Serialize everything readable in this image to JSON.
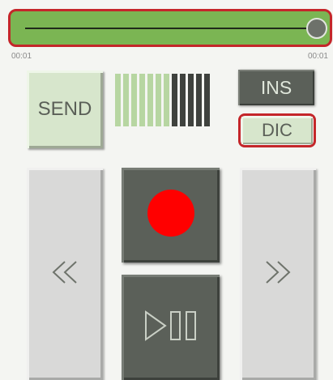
{
  "player": {
    "elapsed_time": "00:01",
    "total_time": "00:01",
    "progress": 1.0,
    "accent_color": "#7bb553",
    "highlight_color": "#c4262a"
  },
  "buttons": {
    "send_label": "SEND",
    "ins_label": "INS",
    "dic_label": "DIC",
    "rewind_icon": "rewind-icon",
    "record_icon": "record-icon",
    "forward_icon": "fast-forward-icon",
    "play_pause_icon": "play-pause-icon"
  },
  "level_meter": {
    "active_bars": 7,
    "total_bars": 12,
    "active_color": "#b7d6a2",
    "inactive_color": "#3f423e"
  }
}
